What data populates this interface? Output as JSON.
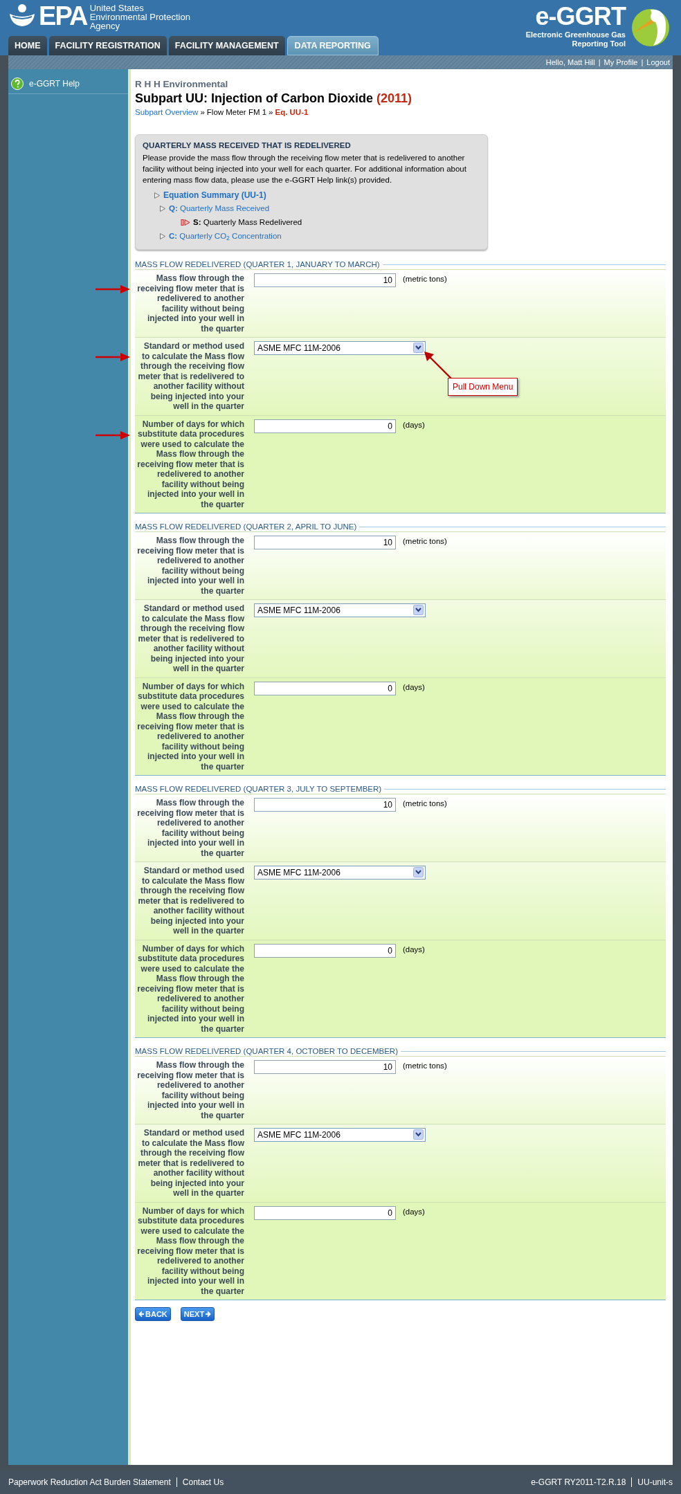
{
  "header": {
    "logo": "EPA",
    "agency": [
      "United States",
      "Environmental Protection",
      "Agency"
    ],
    "tool_name": "e-GGRT",
    "tool_subtitle": "Electronic Greenhouse Gas Reporting Tool"
  },
  "tabs": [
    {
      "label": "HOME",
      "selected": false
    },
    {
      "label": "FACILITY REGISTRATION",
      "selected": false
    },
    {
      "label": "FACILITY MANAGEMENT",
      "selected": false
    },
    {
      "label": "DATA REPORTING",
      "selected": true
    }
  ],
  "user_links": [
    {
      "kind": "greeting",
      "text": "Hello, Matt Hill"
    },
    {
      "kind": "separator",
      "text": "|"
    },
    {
      "kind": "link",
      "text": "My Profile"
    },
    {
      "kind": "separator",
      "text": "|"
    },
    {
      "kind": "link",
      "text": "Logout"
    }
  ],
  "sidebar": {
    "items": [
      "e-GGRT Help"
    ]
  },
  "facility": "R H H Environmental",
  "title": "Subpart UU: Injection of Carbon Dioxide",
  "year": "(2011)",
  "breadcrumb": [
    {
      "text": "Subpart Overview",
      "kind": "link"
    },
    {
      "text": "»",
      "kind": "separator"
    },
    {
      "text": "Flow Meter FM 1",
      "kind": "plain"
    },
    {
      "text": "»",
      "kind": "separator"
    },
    {
      "text": "Eq. UU-1",
      "kind": "current"
    }
  ],
  "info_box": {
    "heading": "QUARTERLY MASS RECEIVED THAT IS REDELIVERED",
    "text": "Please provide the mass flow through the receiving flow meter that is redelivered to another facility without being injected into your well for each quarter. For additional information about entering mass flow data, please use the e-GGRT Help link(s) provided.",
    "summary_link": "Equation Summary (UU-1)",
    "items": [
      {
        "key": "Q:",
        "label": "Quarterly Mass Received",
        "selected": false
      },
      {
        "key": "S:",
        "label": "Quarterly Mass Redelivered",
        "selected": true
      },
      {
        "key": "C:",
        "label": "Quarterly CO$_{2}$ Concentration",
        "selected": false
      }
    ]
  },
  "sections": [
    {
      "title": "MASS FLOW REDELIVERED (QUARTER 1, JANUARY TO MARCH)",
      "fields": [
        {
          "kind": "number",
          "label": "Mass flow through the receiving flow meter that is redelivered to another facility without being injected into your well in the quarter",
          "value": "10",
          "unit": "(metric tons)",
          "arrow": true
        },
        {
          "kind": "select",
          "label": "Standard or method used to calculate the Mass flow through the receiving flow meter that is redelivered to another facility without being injected into your well in the quarter",
          "value": "ASME MFC 11M-2006",
          "arrow": true,
          "callout": "Pull Down Menu"
        },
        {
          "kind": "number",
          "label": "Number of days for which substitute data procedures were used to calculate the Mass flow through the receiving flow meter that is redelivered to another facility without being injected into your well in the quarter",
          "value": "0",
          "unit": "(days)",
          "arrow": true
        }
      ]
    },
    {
      "title": "MASS FLOW REDELIVERED (QUARTER 2, APRIL TO JUNE)",
      "fields": [
        {
          "kind": "number",
          "label": "Mass flow through the receiving flow meter that is redelivered to another facility without being injected into your well in the quarter",
          "value": "10",
          "unit": "(metric tons)",
          "arrow": false
        },
        {
          "kind": "select",
          "label": "Standard or method used to calculate the Mass flow through the receiving flow meter that is redelivered to another facility without being injected into your well in the quarter",
          "value": "ASME MFC 11M-2006",
          "arrow": false
        },
        {
          "kind": "number",
          "label": "Number of days for which substitute data procedures were used to calculate the Mass flow through the receiving flow meter that is redelivered to another facility without being injected into your well in the quarter",
          "value": "0",
          "unit": "(days)",
          "arrow": false
        }
      ]
    },
    {
      "title": "MASS FLOW REDELIVERED (QUARTER 3, JULY TO SEPTEMBER)",
      "fields": [
        {
          "kind": "number",
          "label": "Mass flow through the receiving flow meter that is redelivered to another facility without being injected into your well in the quarter",
          "value": "10",
          "unit": "(metric tons)",
          "arrow": false
        },
        {
          "kind": "select",
          "label": "Standard or method used to calculate the Mass flow through the receiving flow meter that is redelivered to another facility without being injected into your well in the quarter",
          "value": "ASME MFC 11M-2006",
          "arrow": false
        },
        {
          "kind": "number",
          "label": "Number of days for which substitute data procedures were used to calculate the Mass flow through the receiving flow meter that is redelivered to another facility without being injected into your well in the quarter",
          "value": "0",
          "unit": "(days)",
          "arrow": false
        }
      ]
    },
    {
      "title": "MASS FLOW REDELIVERED (QUARTER 4, OCTOBER TO DECEMBER)",
      "fields": [
        {
          "kind": "number",
          "label": "Mass flow through the receiving flow meter that is redelivered to another facility without being injected into your well in the quarter",
          "value": "10",
          "unit": "(metric tons)",
          "arrow": false
        },
        {
          "kind": "select",
          "label": "Standard or method used to calculate the Mass flow through the receiving flow meter that is redelivered to another facility without being injected into your well in the quarter",
          "value": "ASME MFC 11M-2006",
          "arrow": false
        },
        {
          "kind": "number",
          "label": "Number of days for which substitute data procedures were used to calculate the Mass flow through the receiving flow meter that is redelivered to another facility without being injected into your well in the quarter",
          "value": "0",
          "unit": "(days)",
          "arrow": false
        }
      ]
    }
  ],
  "buttons": [
    {
      "label": "BACK",
      "kind": "back"
    },
    {
      "label": "NEXT",
      "kind": "next"
    }
  ],
  "footer": {
    "left": [
      "Paperwork Reduction Act Burden Statement",
      "Contact Us"
    ],
    "right": [
      "e-GGRT RY2011-T2.R.18",
      "UU-unit-s"
    ]
  }
}
